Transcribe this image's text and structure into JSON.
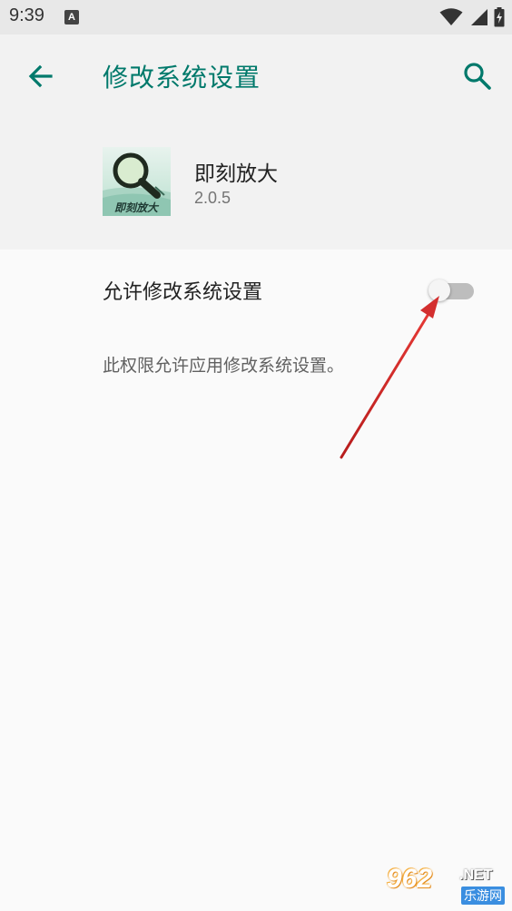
{
  "status_bar": {
    "time": "9:39",
    "notification_icon": "A"
  },
  "header": {
    "title": "修改系统设置",
    "back_icon": "arrow-back-icon",
    "search_icon": "search-icon"
  },
  "app": {
    "name": "即刻放大",
    "version": "2.0.5",
    "icon_text": "即刻放大"
  },
  "setting": {
    "label": "允许修改系统设置",
    "enabled": false,
    "description": "此权限允许应用修改系统设置。"
  },
  "colors": {
    "accent": "#00796b",
    "toggle_off_track": "#bdbdbd",
    "annotation": "#d32f2f"
  },
  "watermark": {
    "main": "962",
    "suffix": ".NET",
    "sub": "乐游网"
  }
}
